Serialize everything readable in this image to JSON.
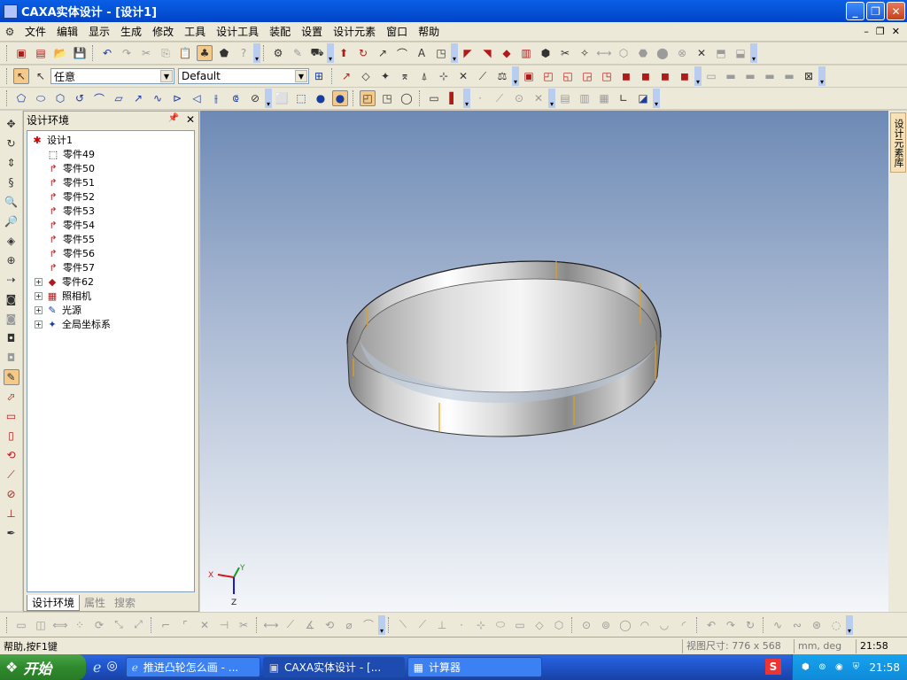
{
  "window": {
    "title": "CAXA实体设计 - [设计1]"
  },
  "menu": [
    "文件",
    "编辑",
    "显示",
    "生成",
    "修改",
    "工具",
    "设计工具",
    "装配",
    "设置",
    "设计元素",
    "窗口",
    "帮助"
  ],
  "toolbar2": {
    "select_combo": "任意",
    "style_combo": "Default"
  },
  "panel": {
    "title": "设计环境",
    "root": "设计1",
    "parts": [
      "零件49",
      "零件50",
      "零件51",
      "零件52",
      "零件53",
      "零件54",
      "零件55",
      "零件56",
      "零件57"
    ],
    "expandables": [
      "零件62",
      "照相机",
      "光源",
      "全局坐标系"
    ],
    "tabs": [
      "设计环境",
      "属性",
      "搜索"
    ]
  },
  "right_tab": "设计元素库",
  "axes": {
    "x": "X",
    "y": "Y",
    "z": "Z"
  },
  "status": {
    "help": "帮助,按F1键",
    "view_size": "视图尺寸: 776 x 568",
    "units": "mm, deg",
    "time": "21:58"
  },
  "taskbar": {
    "start": "开始",
    "tasks": [
      "推进凸轮怎么画 - ...",
      "CAXA实体设计 - [...",
      "计算器"
    ],
    "clock": "21:58"
  }
}
